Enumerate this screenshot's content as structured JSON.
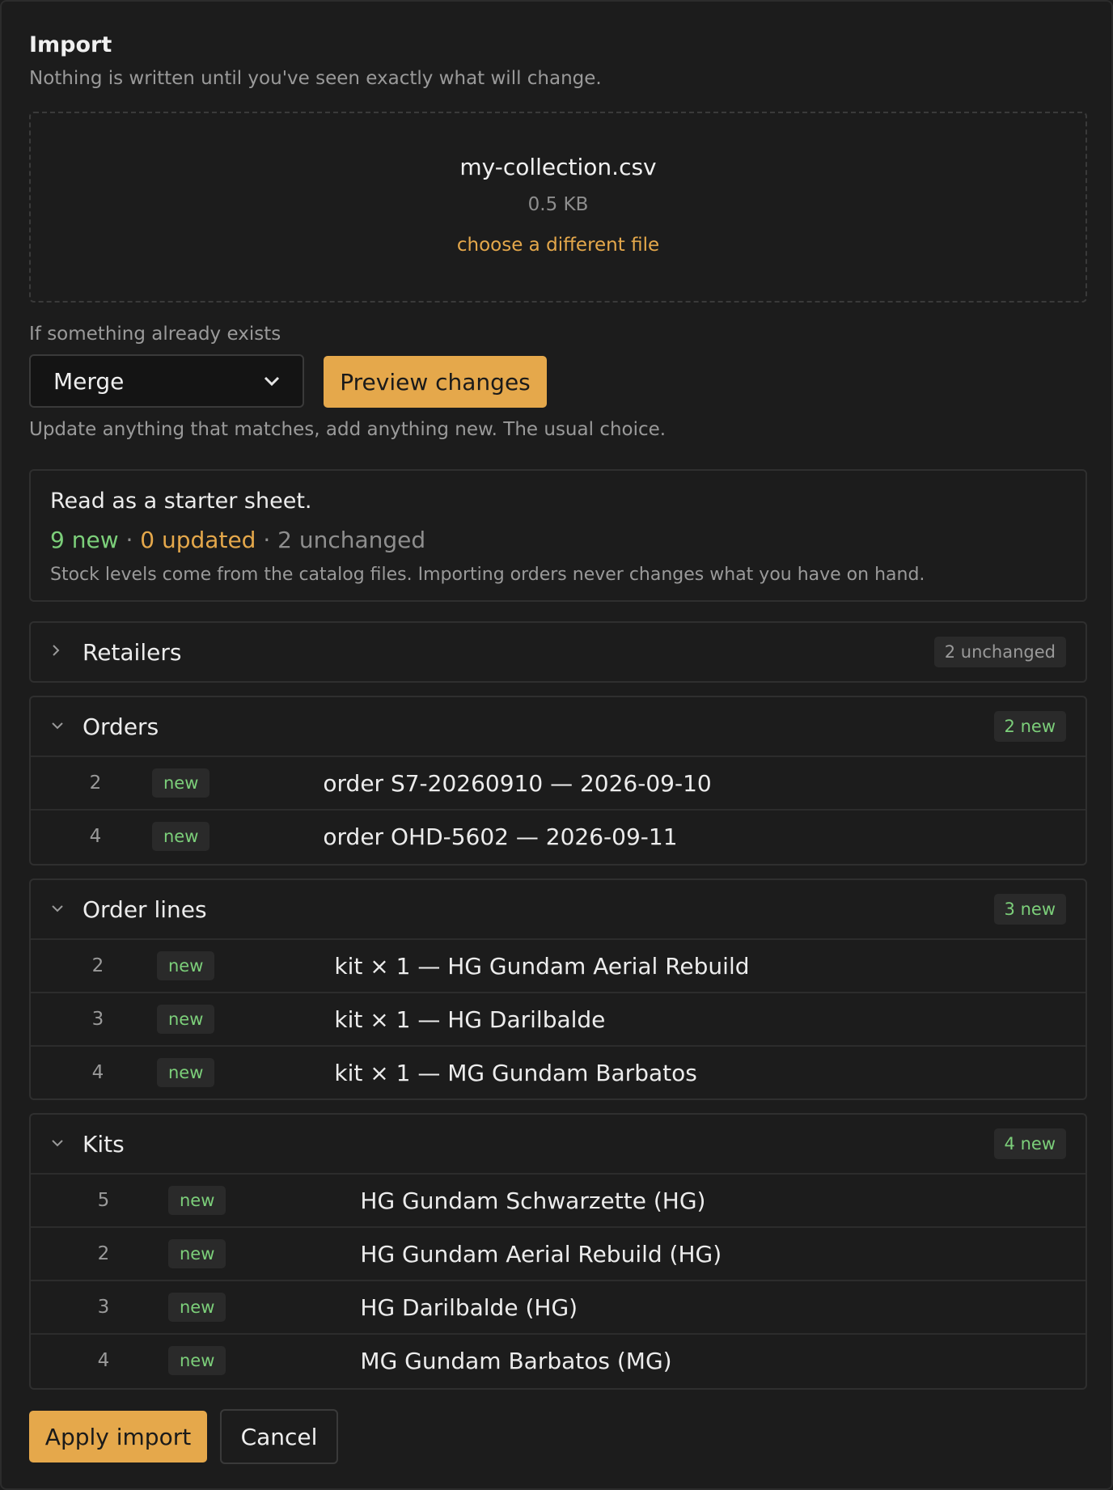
{
  "header": {
    "title": "Import",
    "subtitle": "Nothing is written until you've seen exactly what will change."
  },
  "file": {
    "name": "my-collection.csv",
    "size": "0.5 KB",
    "change_label": "choose a different file"
  },
  "conflict": {
    "label": "If something already exists",
    "selected": "Merge",
    "hint": "Update anything that matches, add anything new. The usual choice."
  },
  "preview_button": "Preview changes",
  "summary": {
    "title": "Read as a starter sheet.",
    "new": "9 new",
    "sep1": " · ",
    "updated": "0 updated",
    "sep2": " · ",
    "unchanged": "2 unchanged",
    "note": "Stock levels come from the catalog files. Importing orders never changes what you have on hand."
  },
  "sections": {
    "retailers": {
      "name": "Retailers",
      "badge": "2 unchanged",
      "expanded": false
    },
    "orders": {
      "name": "Orders",
      "badge": "2 new",
      "expanded": true,
      "rows": [
        {
          "row": "2",
          "status": "new",
          "text": "order S7-20260910 — 2026-09-10"
        },
        {
          "row": "4",
          "status": "new",
          "text": "order OHD-5602 — 2026-09-11"
        }
      ]
    },
    "order_lines": {
      "name": "Order lines",
      "badge": "3 new",
      "expanded": true,
      "rows": [
        {
          "row": "2",
          "status": "new",
          "text": "kit × 1 — HG Gundam Aerial Rebuild"
        },
        {
          "row": "3",
          "status": "new",
          "text": "kit × 1 — HG Darilbalde"
        },
        {
          "row": "4",
          "status": "new",
          "text": "kit × 1 — MG Gundam Barbatos"
        }
      ]
    },
    "kits": {
      "name": "Kits",
      "badge": "4 new",
      "expanded": true,
      "rows": [
        {
          "row": "5",
          "status": "new",
          "text": "HG Gundam Schwarzette (HG)"
        },
        {
          "row": "2",
          "status": "new",
          "text": "HG Gundam Aerial Rebuild (HG)"
        },
        {
          "row": "3",
          "status": "new",
          "text": "HG Darilbalde (HG)"
        },
        {
          "row": "4",
          "status": "new",
          "text": "MG Gundam Barbatos (MG)"
        }
      ]
    }
  },
  "actions": {
    "apply": "Apply import",
    "cancel": "Cancel"
  },
  "colors": {
    "accent": "#e5a84b",
    "new": "#7ccf7a",
    "background": "#1c1c1c"
  }
}
